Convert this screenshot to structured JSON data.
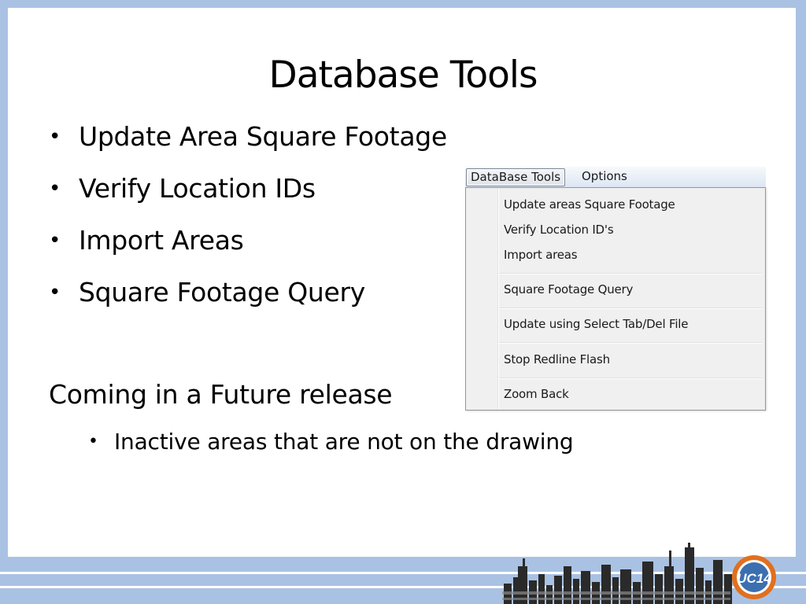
{
  "slide": {
    "title": "Database Tools",
    "bullets": [
      {
        "label": "Update Area Square Footage"
      },
      {
        "label": "Verify Location IDs"
      },
      {
        "label": "Import Areas"
      },
      {
        "label": "Square Footage Query"
      }
    ],
    "bullet_glyph": "•",
    "coming_heading": "Coming in a Future release",
    "sub_bullets": [
      {
        "label": "Inactive areas that are not on the drawing"
      }
    ]
  },
  "menu_screenshot": {
    "menubar": {
      "items": [
        {
          "label": "DataBase Tools",
          "active": true
        },
        {
          "label": "Options",
          "active": false
        }
      ]
    },
    "dropdown": {
      "items": [
        {
          "label": "Update areas Square Footage"
        },
        {
          "label": "Verify Location ID's"
        },
        {
          "label": "Import areas"
        },
        {
          "label": "Square Footage Query"
        },
        {
          "label": "Update using Select Tab/Del File"
        },
        {
          "label": "Stop Redline Flash"
        },
        {
          "label": "Zoom Back"
        }
      ]
    }
  },
  "footer": {
    "logo_text": "UC14",
    "colors": {
      "band": "#a9c2e3",
      "logo_orange": "#e0701f",
      "logo_blue": "#3c6fb0"
    }
  }
}
